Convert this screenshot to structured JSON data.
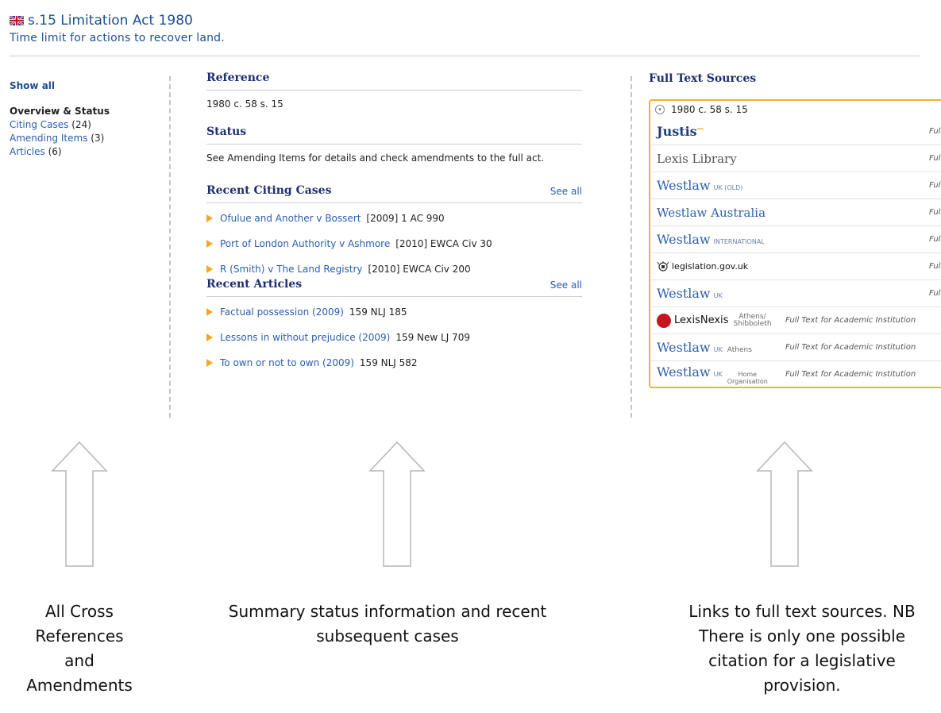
{
  "header": {
    "title": "s.15 Limitation Act 1980",
    "subtitle": "Time limit for actions to recover land."
  },
  "leftnav": {
    "show_all": "Show all",
    "overview": "Overview & Status",
    "items": [
      {
        "label": "Citing Cases",
        "count": "(24)"
      },
      {
        "label": "Amending Items",
        "count": "(3)"
      },
      {
        "label": "Articles",
        "count": "(6)"
      }
    ]
  },
  "main": {
    "reference": {
      "heading": "Reference",
      "value": "1980 c. 58 s. 15"
    },
    "status": {
      "heading": "Status",
      "text": "See Amending Items for details and check amendments to the full act."
    },
    "citing": {
      "heading": "Recent Citing Cases",
      "see_all": "See all",
      "items": [
        {
          "title": "Ofulue and Another v Bossert",
          "cite": "[2009] 1 AC 990"
        },
        {
          "title": "Port of London Authority v Ashmore",
          "cite": "[2010] EWCA Civ 30"
        },
        {
          "title": "R (Smith) v The Land Registry",
          "cite": "[2010] EWCA Civ 200"
        }
      ]
    },
    "articles": {
      "heading": "Recent Articles",
      "see_all": "See all",
      "items": [
        {
          "title": "Factual possession (2009)",
          "cite": "159 NLJ 185"
        },
        {
          "title": "Lessons in without prejudice (2009)",
          "cite": "159 New LJ 709"
        },
        {
          "title": "To own or not to own (2009)",
          "cite": "159 NLJ 582"
        }
      ]
    }
  },
  "fulltext": {
    "heading": "Full Text Sources",
    "citation": "1980 c. 58 s. 15",
    "full_text_short": "Full Tex",
    "full_text_academic": "Full Text for Academic Institution",
    "sources": {
      "justis": "Justis",
      "lexis_library": "Lexis Library",
      "westlaw": "Westlaw",
      "uk": "UK",
      "uk_old": "UK (OLD)",
      "westlaw_australia": "Westlaw Australia",
      "international": "INTERNATIONAL",
      "legislation": "legislation.gov.uk",
      "lexisnexis": "LexisNexis",
      "athens_shibboleth_1": "Athens/",
      "athens_shibboleth_2": "Shibboleth",
      "athens": "Athens",
      "home": "Home",
      "organisation": "Organisation"
    }
  },
  "captions": {
    "left": [
      "All Cross",
      "References",
      "and",
      "Amendments"
    ],
    "middle": [
      "Summary status information and recent",
      "subsequent cases"
    ],
    "right": [
      "Links to full text sources.  NB",
      "There is only one possible",
      "citation for a legislative",
      "provision."
    ]
  },
  "colors": {
    "accent": "#f0b429",
    "heading": "#1d2f6e",
    "link": "#2a5db0",
    "bullet": "#f5a623"
  }
}
